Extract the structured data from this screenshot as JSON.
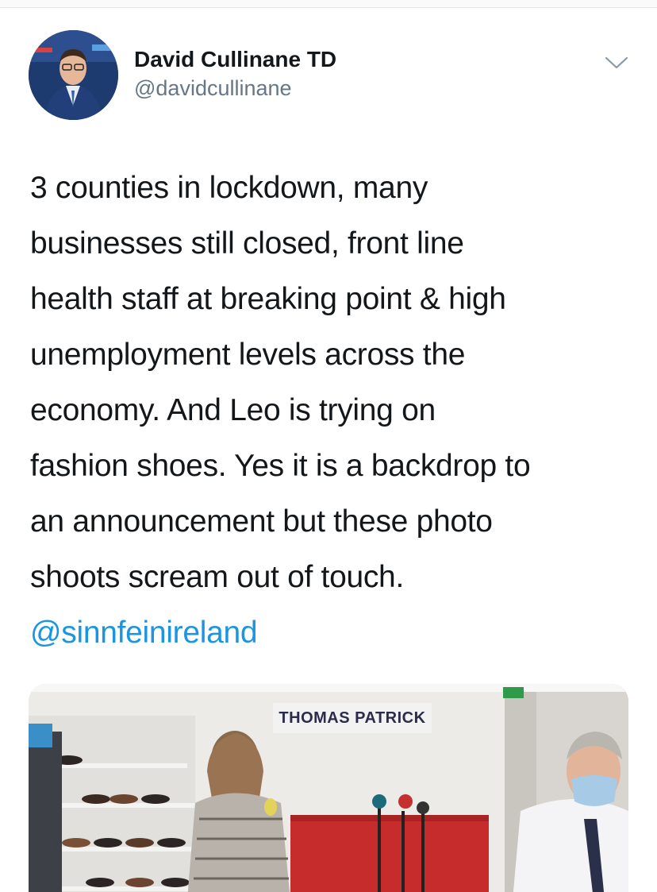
{
  "tweet": {
    "author": {
      "display_name": "David Cullinane TD",
      "handle": "@davidcullinane"
    },
    "body_lines": [
      "3 counties in lockdown, many",
      "businesses still closed, front line",
      "health staff at breaking point & high",
      "unemployment levels across the",
      "economy. And Leo is trying on",
      "fashion shoes. Yes it is a backdrop to",
      "an announcement but these photo",
      "shoots scream out of touch."
    ],
    "mention": "@sinnfeinireland",
    "media": {
      "sign_text": "THOMAS PATRICK"
    }
  },
  "colors": {
    "link": "#1b95e0",
    "secondary_text": "#657786",
    "primary_text": "#14171a"
  },
  "icons": {
    "menu": "chevron-down-icon"
  }
}
